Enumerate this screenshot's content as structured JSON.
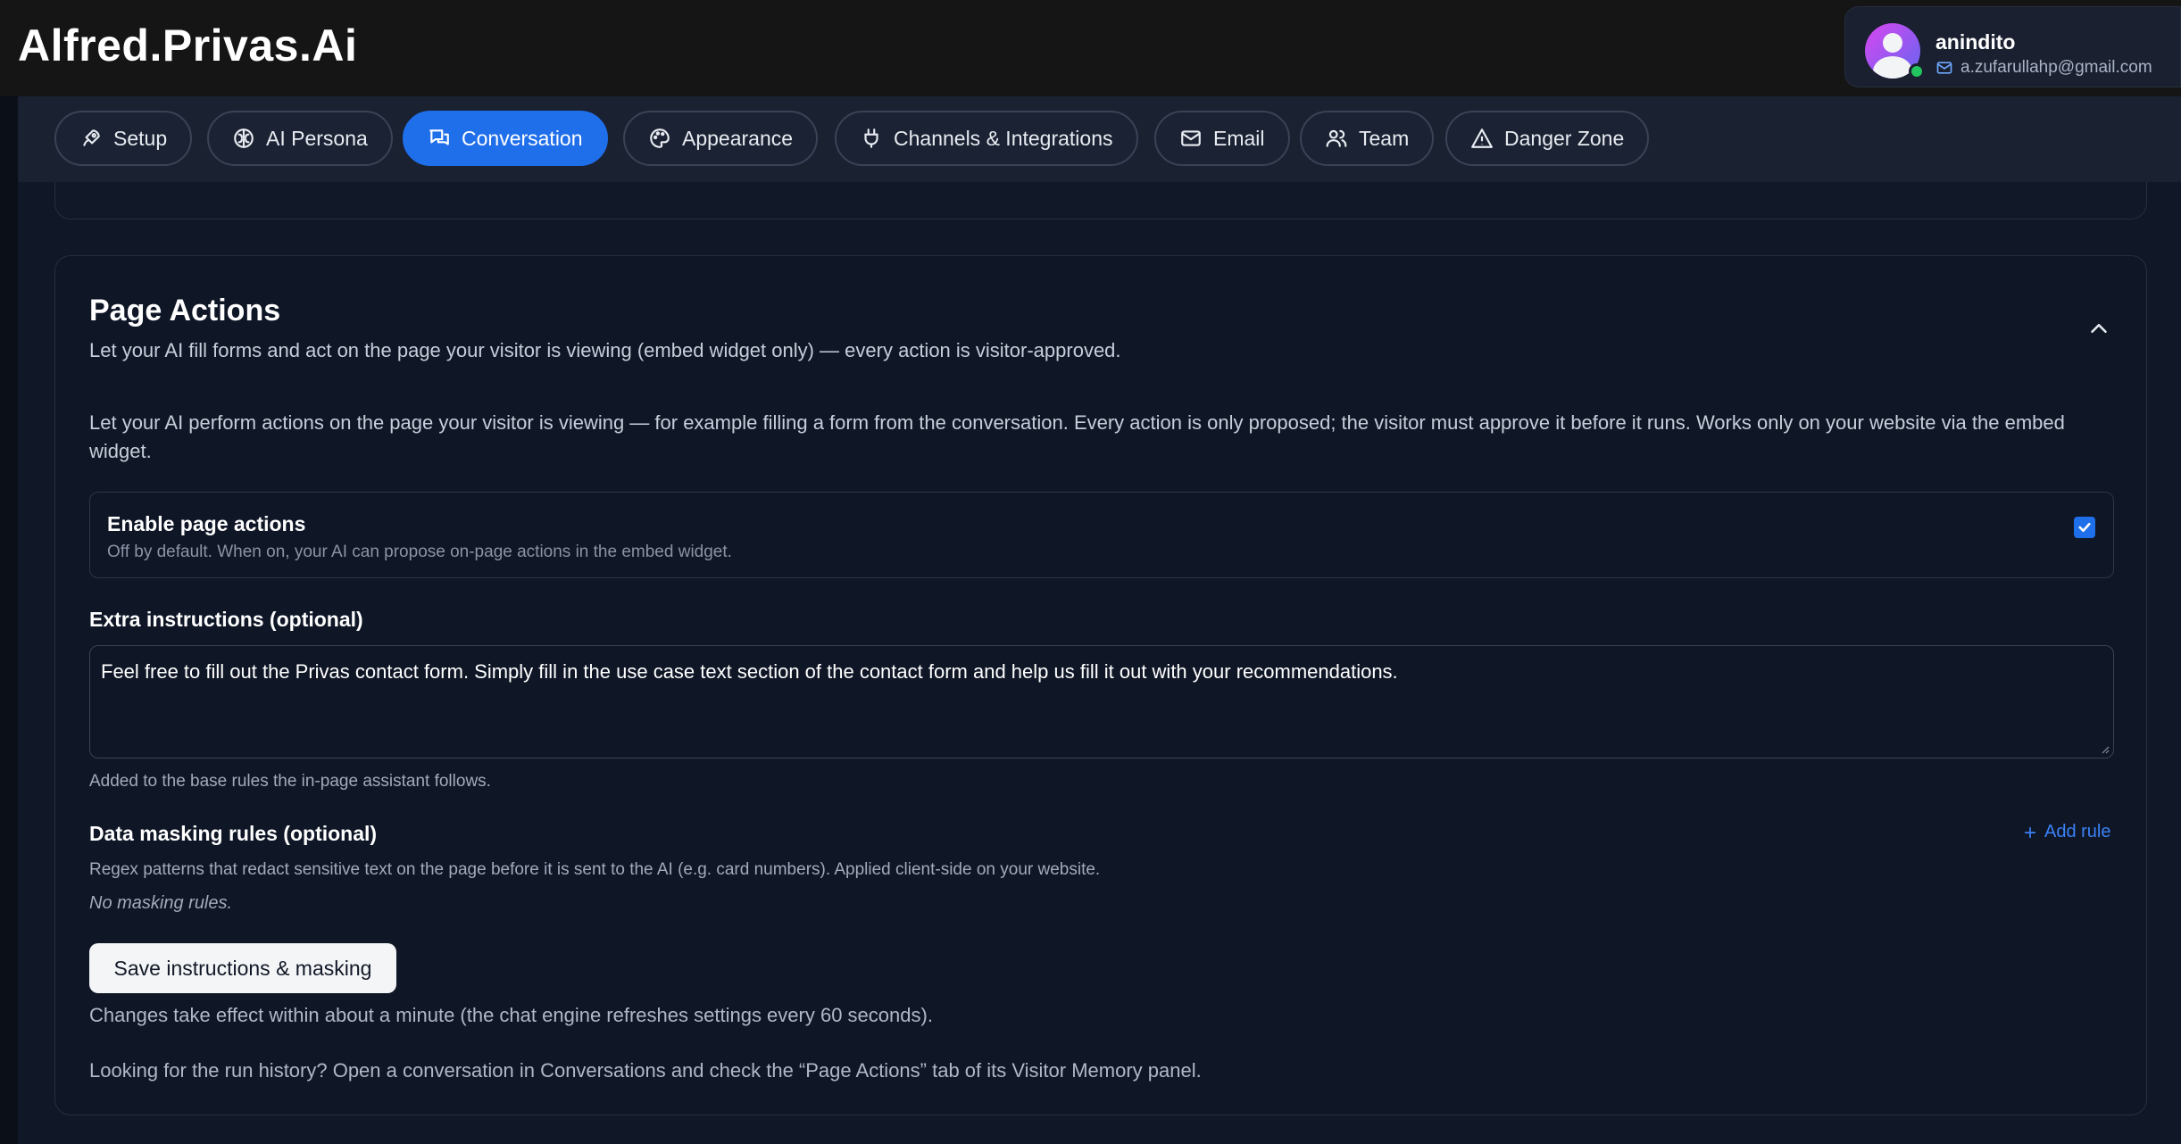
{
  "app": {
    "title": "Alfred.Privas.Ai"
  },
  "user": {
    "name": "anindito",
    "email": "a.zufarullahp@gmail.com",
    "avatar_icon": "user-avatar-icon",
    "status_color": "#22c55e"
  },
  "tabs": [
    {
      "label": "Setup",
      "icon": "rocket-icon",
      "active": false
    },
    {
      "label": "AI Persona",
      "icon": "brain-icon",
      "active": false
    },
    {
      "label": "Conversation",
      "icon": "chat-bubbles-icon",
      "active": true
    },
    {
      "label": "Appearance",
      "icon": "palette-icon",
      "active": false
    },
    {
      "label": "Channels & Integrations",
      "icon": "plug-icon",
      "active": false
    },
    {
      "label": "Email",
      "icon": "mail-icon",
      "active": false
    },
    {
      "label": "Team",
      "icon": "users-icon",
      "active": false
    },
    {
      "label": "Danger Zone",
      "icon": "warning-triangle-icon",
      "active": false
    }
  ],
  "page_actions": {
    "title": "Page Actions",
    "subtitle": "Let your AI fill forms and act on the page your visitor is viewing (embed widget only) — every action is visitor-approved.",
    "intro": "Let your AI perform actions on the page your visitor is viewing — for example filling a form from the conversation. Every action is only proposed; the visitor must approve it before it runs. Works only on your website via the embed widget.",
    "enable": {
      "title": "Enable page actions",
      "description": "Off by default. When on, your AI can propose on-page actions in the embed widget.",
      "checked": true
    },
    "extra_instructions": {
      "label": "Extra instructions (optional)",
      "value": "Feel free to fill out the Privas contact form. Simply fill in the use case text section of the contact form and help us fill it out with your recommendations.",
      "help": "Added to the base rules the in-page assistant follows."
    },
    "masking": {
      "label": "Data masking rules (optional)",
      "add_rule": "Add rule",
      "description": "Regex patterns that redact sensitive text on the page before it is sent to the AI (e.g. card numbers). Applied client-side on your website.",
      "empty": "No masking rules."
    },
    "save_label": "Save instructions & masking",
    "save_note": "Changes take effect within about a minute (the chat engine refreshes settings every 60 seconds).",
    "history_note": "Looking for the run history? Open a conversation in Conversations and check the “Page Actions” tab of its Visitor Memory panel."
  },
  "colors": {
    "accent": "#1f6feb",
    "background": "#101726",
    "link": "#3b82f6"
  }
}
